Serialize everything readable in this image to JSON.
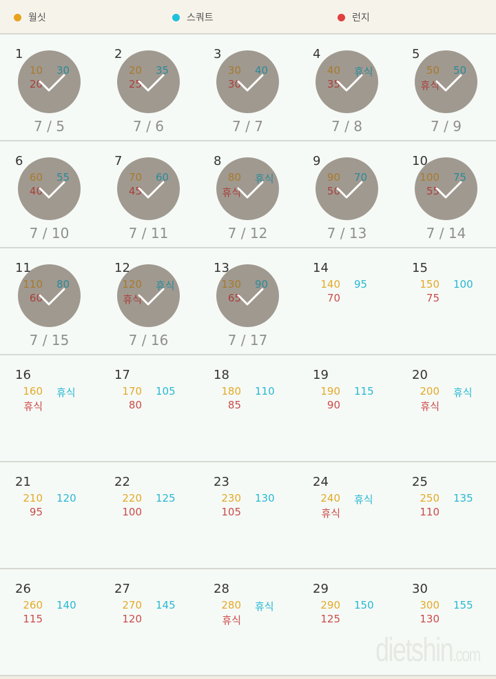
{
  "legend": [
    {
      "label": "월싯",
      "color": "#e8a21b"
    },
    {
      "label": "스쿼트",
      "color": "#1fc0de"
    },
    {
      "label": "런지",
      "color": "#e0403e"
    }
  ],
  "days": [
    {
      "day": "1",
      "wallsit": "10",
      "squat": "30",
      "lunge": "20",
      "date": "7/5",
      "done": true
    },
    {
      "day": "2",
      "wallsit": "20",
      "squat": "35",
      "lunge": "25",
      "date": "7/6",
      "done": true
    },
    {
      "day": "3",
      "wallsit": "30",
      "squat": "40",
      "lunge": "30",
      "date": "7/7",
      "done": true
    },
    {
      "day": "4",
      "wallsit": "40",
      "squat": "휴식",
      "lunge": "35",
      "date": "7/8",
      "done": true
    },
    {
      "day": "5",
      "wallsit": "50",
      "squat": "50",
      "lunge": "휴식",
      "date": "7/9",
      "done": true
    },
    {
      "day": "6",
      "wallsit": "60",
      "squat": "55",
      "lunge": "40",
      "date": "7/10",
      "done": true
    },
    {
      "day": "7",
      "wallsit": "70",
      "squat": "60",
      "lunge": "45",
      "date": "7/11",
      "done": true
    },
    {
      "day": "8",
      "wallsit": "80",
      "squat": "휴식",
      "lunge": "휴식",
      "date": "7/12",
      "done": true
    },
    {
      "day": "9",
      "wallsit": "90",
      "squat": "70",
      "lunge": "50",
      "date": "7/13",
      "done": true
    },
    {
      "day": "10",
      "wallsit": "100",
      "squat": "75",
      "lunge": "55",
      "date": "7/14",
      "done": true
    },
    {
      "day": "11",
      "wallsit": "110",
      "squat": "80",
      "lunge": "60",
      "date": "7/15",
      "done": true
    },
    {
      "day": "12",
      "wallsit": "120",
      "squat": "휴식",
      "lunge": "휴식",
      "date": "7/16",
      "done": true
    },
    {
      "day": "13",
      "wallsit": "130",
      "squat": "90",
      "lunge": "65",
      "date": "7/17",
      "done": true
    },
    {
      "day": "14",
      "wallsit": "140",
      "squat": "95",
      "lunge": "70",
      "date": "",
      "done": false
    },
    {
      "day": "15",
      "wallsit": "150",
      "squat": "100",
      "lunge": "75",
      "date": "",
      "done": false
    },
    {
      "day": "16",
      "wallsit": "160",
      "squat": "휴식",
      "lunge": "휴식",
      "date": "",
      "done": false
    },
    {
      "day": "17",
      "wallsit": "170",
      "squat": "105",
      "lunge": "80",
      "date": "",
      "done": false
    },
    {
      "day": "18",
      "wallsit": "180",
      "squat": "110",
      "lunge": "85",
      "date": "",
      "done": false
    },
    {
      "day": "19",
      "wallsit": "190",
      "squat": "115",
      "lunge": "90",
      "date": "",
      "done": false
    },
    {
      "day": "20",
      "wallsit": "200",
      "squat": "휴식",
      "lunge": "휴식",
      "date": "",
      "done": false
    },
    {
      "day": "21",
      "wallsit": "210",
      "squat": "120",
      "lunge": "95",
      "date": "",
      "done": false
    },
    {
      "day": "22",
      "wallsit": "220",
      "squat": "125",
      "lunge": "100",
      "date": "",
      "done": false
    },
    {
      "day": "23",
      "wallsit": "230",
      "squat": "130",
      "lunge": "105",
      "date": "",
      "done": false
    },
    {
      "day": "24",
      "wallsit": "240",
      "squat": "휴식",
      "lunge": "휴식",
      "date": "",
      "done": false
    },
    {
      "day": "25",
      "wallsit": "250",
      "squat": "135",
      "lunge": "110",
      "date": "",
      "done": false
    },
    {
      "day": "26",
      "wallsit": "260",
      "squat": "140",
      "lunge": "115",
      "date": "",
      "done": false
    },
    {
      "day": "27",
      "wallsit": "270",
      "squat": "145",
      "lunge": "120",
      "date": "",
      "done": false
    },
    {
      "day": "28",
      "wallsit": "280",
      "squat": "휴식",
      "lunge": "휴식",
      "date": "",
      "done": false
    },
    {
      "day": "29",
      "wallsit": "290",
      "squat": "150",
      "lunge": "125",
      "date": "",
      "done": false
    },
    {
      "day": "30",
      "wallsit": "300",
      "squat": "155",
      "lunge": "130",
      "date": "",
      "done": false
    }
  ],
  "watermark": {
    "main": "dietshin",
    "suffix": ".com"
  }
}
